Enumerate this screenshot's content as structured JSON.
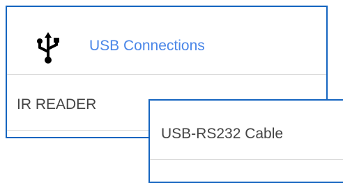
{
  "menu": {
    "usb_connections_label": "USB Connections",
    "ir_reader_label": "IR READER",
    "usb_icon": "usb-icon",
    "accent_color": "#4a86e8",
    "border_color": "#1565c0"
  },
  "popup": {
    "items": [
      {
        "label": "USB-RS232 Cable"
      }
    ]
  }
}
